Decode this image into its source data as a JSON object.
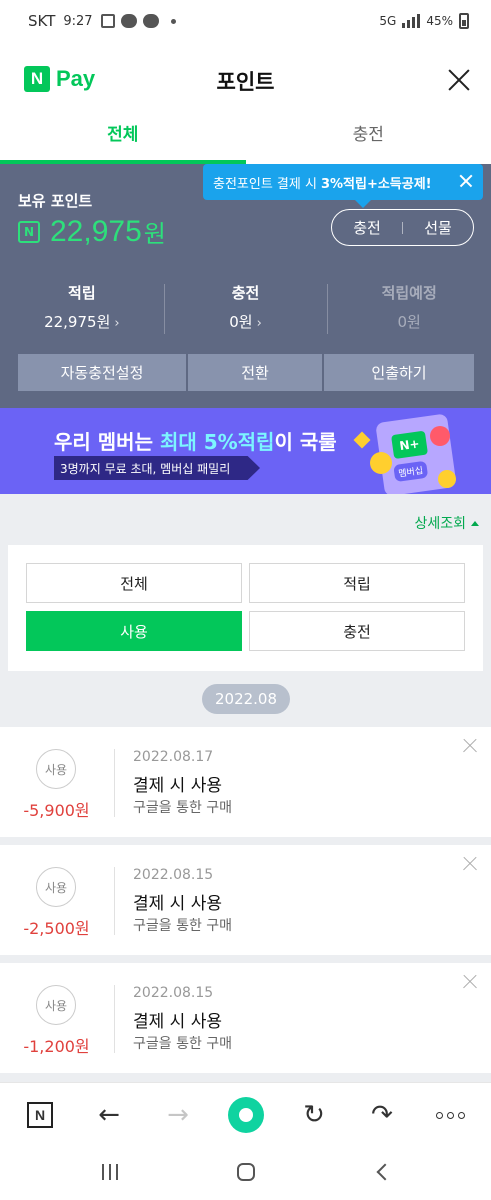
{
  "status_bar": {
    "carrier": "SKT",
    "time": "9:27",
    "network": "5G",
    "battery": "45%"
  },
  "header": {
    "logo_n": "N",
    "logo_pay": "Pay",
    "title": "포인트"
  },
  "tabs": [
    {
      "label": "전체",
      "active": true
    },
    {
      "label": "충전",
      "active": false
    }
  ],
  "tooltip": {
    "text": "충전포인트 결제 시",
    "highlight": "3%적립+소득공제!"
  },
  "points": {
    "label": "보유 포인트",
    "icon": "N",
    "value": "22,975",
    "unit": "원",
    "charge_label": "충전",
    "gift_label": "선물"
  },
  "stats": [
    {
      "label": "적립",
      "value": "22,975원"
    },
    {
      "label": "충전",
      "value": "0원"
    },
    {
      "label": "적립예정",
      "value": "0원"
    }
  ],
  "actions": {
    "auto_charge": "자동충전설정",
    "convert": "전환",
    "withdraw": "인출하기"
  },
  "banner": {
    "title_pre": "우리 멤버는 ",
    "title_highlight": "최대 5%적립",
    "title_post": "이 국룰",
    "subtitle": "3명까지 무료 초대, 멤버십 패밀리",
    "card_text": "N+",
    "card_label": "멤버십"
  },
  "detail_link": "상세조회",
  "filters": [
    {
      "label": "전체",
      "selected": false
    },
    {
      "label": "적립",
      "selected": false
    },
    {
      "label": "사용",
      "selected": true
    },
    {
      "label": "충전",
      "selected": false
    }
  ],
  "month": "2022.08",
  "transactions": [
    {
      "type": "사용",
      "amount": "-5,900원",
      "date": "2022.08.17",
      "title": "결제 시 사용",
      "desc": "구글을 통한 구매"
    },
    {
      "type": "사용",
      "amount": "-2,500원",
      "date": "2022.08.15",
      "title": "결제 시 사용",
      "desc": "구글을 통한 구매"
    },
    {
      "type": "사용",
      "amount": "-1,200원",
      "date": "2022.08.15",
      "title": "결제 시 사용",
      "desc": "구글을 통한 구매"
    }
  ],
  "toolbar": {
    "home_letter": "N",
    "back_glyph": "←",
    "forward_glyph": "→",
    "refresh_glyph": "↻",
    "share_glyph": "↷"
  },
  "colors": {
    "brand_green": "#03c75a",
    "panel_bg": "#5f6983",
    "negative_red": "#e0413d",
    "tooltip_blue": "#1aa3ec",
    "banner_purple": "#6b63f5"
  }
}
